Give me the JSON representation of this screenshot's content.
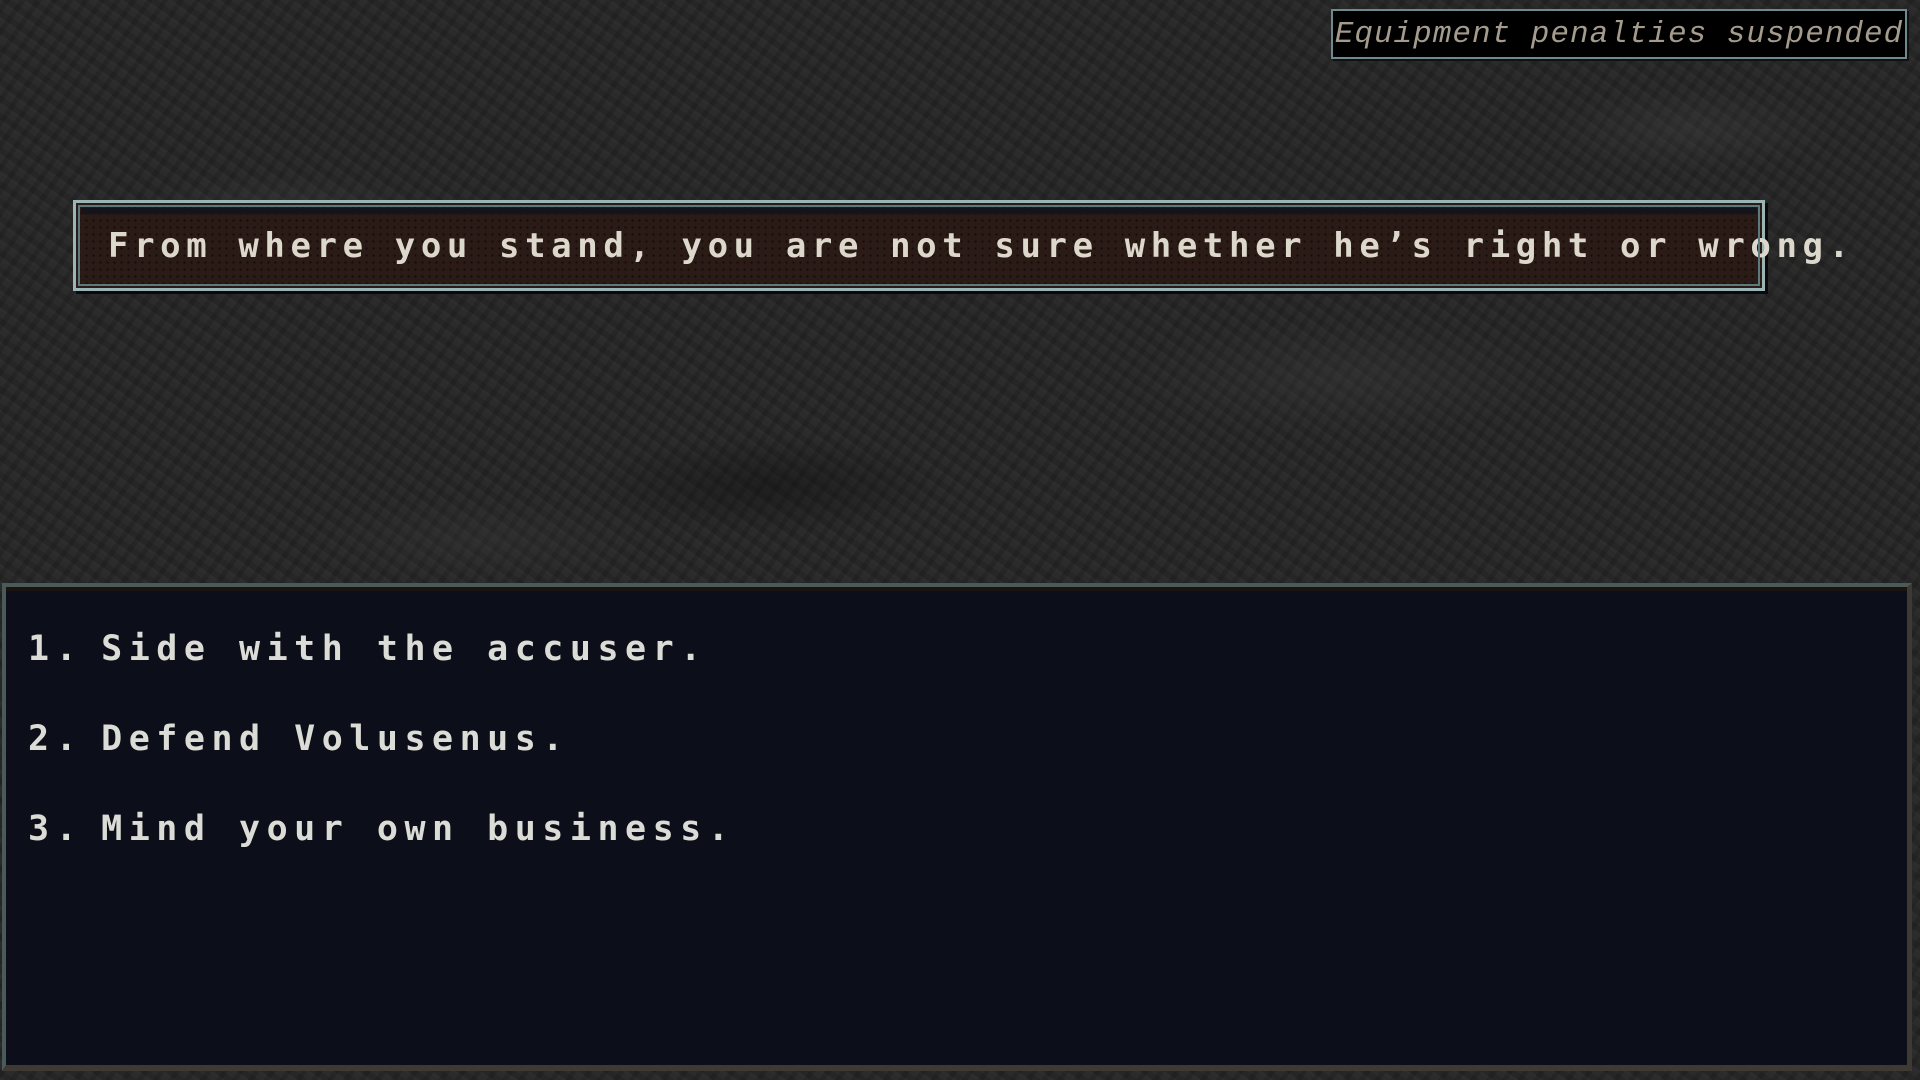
{
  "status": {
    "text": "Equipment penalties suspended"
  },
  "narration": {
    "text": "From where you stand, you are not sure whether he’s right or wrong."
  },
  "choices": [
    {
      "number": "1.",
      "label": "Side with the accuser."
    },
    {
      "number": "2.",
      "label": "Defend Volusenus."
    },
    {
      "number": "3.",
      "label": "Mind your own business."
    }
  ]
}
